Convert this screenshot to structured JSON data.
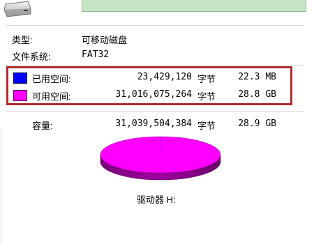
{
  "name_field": {
    "value": ""
  },
  "info": {
    "type_label": "类型:",
    "type_value": "可移动磁盘",
    "fs_label": "文件系统:",
    "fs_value": "FAT32"
  },
  "used": {
    "label": "已用空间:",
    "bytes": "23,429,120",
    "unit": "字节",
    "size": "22.3 MB",
    "color": "#0000ff"
  },
  "free": {
    "label": "可用空间:",
    "bytes": "31,016,075,264",
    "unit": "字节",
    "size": "28.8 GB",
    "color": "#ff00ff"
  },
  "capacity": {
    "label": "容量:",
    "bytes": "31,039,504,384",
    "unit": "字节",
    "size": "28.9 GB"
  },
  "drive_label": "驱动器 H:",
  "pie": {
    "used_fraction": 0.00075,
    "free_fraction": 0.99925
  }
}
